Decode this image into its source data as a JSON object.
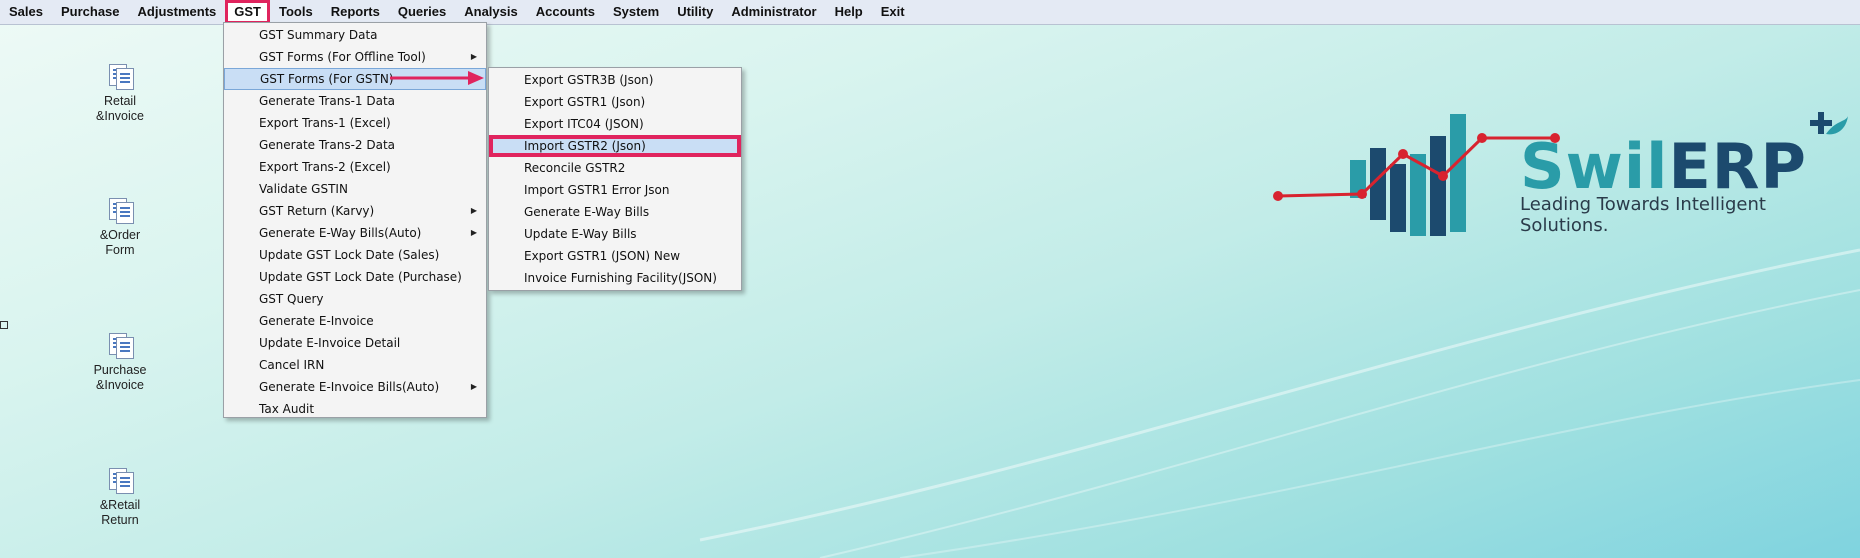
{
  "menubar": {
    "items": [
      "Sales",
      "Purchase",
      "Adjustments",
      "GST",
      "Tools",
      "Reports",
      "Queries",
      "Analysis",
      "Accounts",
      "System",
      "Utility",
      "Administrator",
      "Help",
      "Exit"
    ]
  },
  "desktop": {
    "icons": [
      {
        "line1": "Retail",
        "line2": "&Invoice"
      },
      {
        "line1": "&Order",
        "line2": "Form"
      },
      {
        "line1": "Purchase",
        "line2": "&Invoice"
      },
      {
        "line1": "&Retail",
        "line2": "Return"
      }
    ]
  },
  "gst_menu": {
    "items": [
      {
        "label": "GST Summary Data"
      },
      {
        "label": "GST Forms (For Offline Tool)",
        "submenu": true
      },
      {
        "label": "GST Forms (For GSTN)",
        "submenu": true
      },
      {
        "label": "Generate Trans-1 Data"
      },
      {
        "label": "Export Trans-1 (Excel)"
      },
      {
        "label": "Generate Trans-2 Data"
      },
      {
        "label": "Export Trans-2 (Excel)"
      },
      {
        "label": "Validate GSTIN"
      },
      {
        "label": "GST Return (Karvy)",
        "submenu": true
      },
      {
        "label": "Generate E-Way Bills(Auto)",
        "submenu": true
      },
      {
        "label": "Update GST Lock Date (Sales)"
      },
      {
        "label": "Update GST Lock Date (Purchase)"
      },
      {
        "label": "GST Query"
      },
      {
        "label": "Generate E-Invoice"
      },
      {
        "label": "Update E-Invoice Detail"
      },
      {
        "label": "Cancel IRN"
      },
      {
        "label": "Generate E-Invoice Bills(Auto)",
        "submenu": true
      },
      {
        "label": "Tax Audit"
      }
    ]
  },
  "gstn_submenu": {
    "items": [
      "Export GSTR3B (Json)",
      "Export GSTR1 (Json)",
      "Export ITC04 (JSON)",
      "Import GSTR2 (Json)",
      "Reconcile GSTR2",
      "Import GSTR1 Error Json",
      "Generate E-Way Bills",
      "Update E-Way Bills",
      "Export GSTR1 (JSON) New",
      "Invoice Furnishing Facility(JSON)"
    ]
  },
  "logo": {
    "brand_part1": "Swil",
    "brand_part2": "ERP",
    "tagline": "Leading Towards Intelligent Solutions."
  },
  "colors": {
    "highlight": "#e0245e",
    "brand_dark": "#1c4a6e",
    "brand_teal": "#2a9ca8"
  }
}
